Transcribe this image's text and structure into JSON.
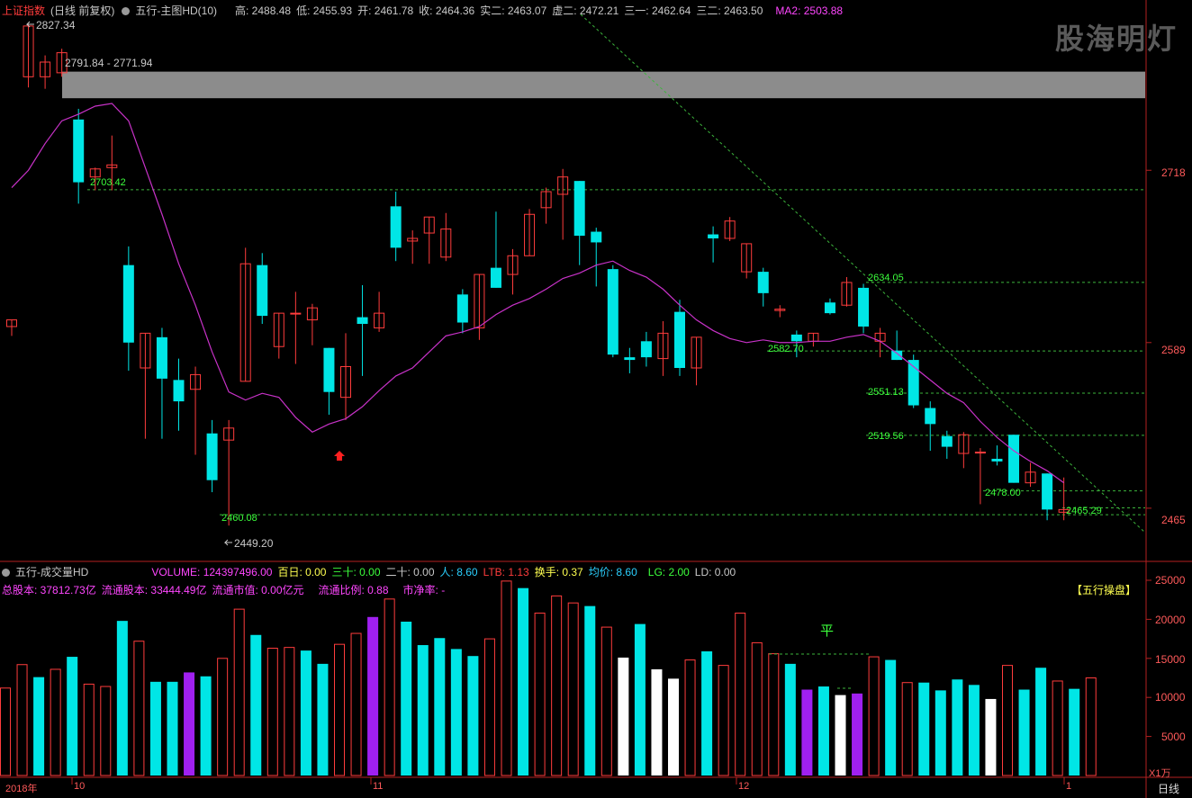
{
  "header": {
    "index_name": "上证指数",
    "period": "(日线 前复权)",
    "indicator_name": "五行-主图HD(10)",
    "high": "高: 2488.48",
    "low": "低: 2455.93",
    "open": "开: 2461.78",
    "close": "收: 2464.36",
    "shi2": "实二: 2463.07",
    "xu2": "虚二: 2472.21",
    "san1": "三一: 2462.64",
    "san2": "三二: 2463.50",
    "ma2": "MA2: 2503.88"
  },
  "watermark": "股海明灯",
  "price_axis": [
    "2718",
    "2589",
    "2465"
  ],
  "price_annotations": {
    "max": "2827.34",
    "min": "2449.20",
    "zone": "2791.84 - 2771.94",
    "levels": [
      "2703.42",
      "2634.05",
      "2582.70",
      "2551.13",
      "2519.56",
      "2478.00",
      "2465.29",
      "2460.08"
    ]
  },
  "volume_header": {
    "title": "五行-成交量HD",
    "volume": "VOLUME: 124397496.00",
    "bairi": "百日: 0.00",
    "sanshi": "三十: 0.00",
    "ershi": "二十: 0.00",
    "ren": "人: 8.60",
    "ltb": "LTB: 1.13",
    "huanshou": "换手: 0.37",
    "junjia": "均价: 8.60",
    "lg": "LG: 2.00",
    "ld": "LD: 0.00"
  },
  "info_row": {
    "total_shares": "总股本: 37812.73亿",
    "float_shares": "流通股本: 33444.49亿",
    "float_value": "流通市值: 0.00亿元",
    "float_ratio": "流通比例: 0.88",
    "pb": "市净率: -"
  },
  "badge": "【五行操盘】",
  "volume_axis": [
    "25000",
    "20000",
    "15000",
    "10000",
    "5000"
  ],
  "volume_unit": "X1万",
  "ping_label": "平",
  "date_axis": [
    "2018年",
    "10",
    "11",
    "12",
    "1"
  ],
  "period_button": "日线",
  "colors": {
    "up": "#ff3c3c",
    "down": "#00e6e6",
    "ma": "#c832c8",
    "guide": "#3cb43c"
  },
  "chart_data": {
    "type": "candlestick",
    "price_ylim": [
      2440,
      2832
    ],
    "candles": [
      {
        "o": 2601,
        "h": 2606,
        "l": 2594,
        "c": 2606
      },
      {
        "o": 2788,
        "h": 2827,
        "l": 2780,
        "c": 2826
      },
      {
        "o": 2788,
        "h": 2804,
        "l": 2779,
        "c": 2799
      },
      {
        "o": 2791,
        "h": 2809,
        "l": 2788,
        "c": 2806
      },
      {
        "o": 2756,
        "h": 2764,
        "l": 2693,
        "c": 2709
      },
      {
        "o": 2713,
        "h": 2720,
        "l": 2703,
        "c": 2719
      },
      {
        "o": 2720,
        "h": 2744,
        "l": 2703,
        "c": 2722
      },
      {
        "o": 2647,
        "h": 2661,
        "l": 2568,
        "c": 2589
      },
      {
        "o": 2570,
        "h": 2587,
        "l": 2517,
        "c": 2596
      },
      {
        "o": 2593,
        "h": 2600,
        "l": 2517,
        "c": 2562
      },
      {
        "o": 2561,
        "h": 2577,
        "l": 2523,
        "c": 2545
      },
      {
        "o": 2554,
        "h": 2571,
        "l": 2505,
        "c": 2565
      },
      {
        "o": 2521,
        "h": 2531,
        "l": 2477,
        "c": 2486
      },
      {
        "o": 2516,
        "h": 2531,
        "l": 2452,
        "c": 2525
      },
      {
        "o": 2560,
        "h": 2660,
        "l": 2560,
        "c": 2648
      },
      {
        "o": 2647,
        "h": 2656,
        "l": 2603,
        "c": 2609
      },
      {
        "o": 2586,
        "h": 2611,
        "l": 2577,
        "c": 2611
      },
      {
        "o": 2611,
        "h": 2627,
        "l": 2573,
        "c": 2611
      },
      {
        "o": 2606,
        "h": 2618,
        "l": 2587,
        "c": 2615
      },
      {
        "o": 2585,
        "h": 2580,
        "l": 2535,
        "c": 2552
      },
      {
        "o": 2548,
        "h": 2596,
        "l": 2531,
        "c": 2571
      },
      {
        "o": 2608,
        "h": 2632,
        "l": 2564,
        "c": 2603
      },
      {
        "o": 2600,
        "h": 2627,
        "l": 2597,
        "c": 2611
      },
      {
        "o": 2691,
        "h": 2702,
        "l": 2650,
        "c": 2660
      },
      {
        "o": 2665,
        "h": 2673,
        "l": 2648,
        "c": 2667
      },
      {
        "o": 2671,
        "h": 2674,
        "l": 2648,
        "c": 2683
      },
      {
        "o": 2653,
        "h": 2686,
        "l": 2650,
        "c": 2674
      },
      {
        "o": 2625,
        "h": 2629,
        "l": 2596,
        "c": 2604
      },
      {
        "o": 2600,
        "h": 2636,
        "l": 2591,
        "c": 2640
      },
      {
        "o": 2645,
        "h": 2687,
        "l": 2638,
        "c": 2630
      },
      {
        "o": 2640,
        "h": 2659,
        "l": 2625,
        "c": 2654
      },
      {
        "o": 2654,
        "h": 2689,
        "l": 2654,
        "c": 2685
      },
      {
        "o": 2690,
        "h": 2705,
        "l": 2678,
        "c": 2702
      },
      {
        "o": 2700,
        "h": 2719,
        "l": 2666,
        "c": 2713
      },
      {
        "o": 2710,
        "h": 2701,
        "l": 2647,
        "c": 2669
      },
      {
        "o": 2672,
        "h": 2675,
        "l": 2631,
        "c": 2664
      },
      {
        "o": 2644,
        "h": 2647,
        "l": 2578,
        "c": 2580
      },
      {
        "o": 2578,
        "h": 2585,
        "l": 2566,
        "c": 2576
      },
      {
        "o": 2590,
        "h": 2597,
        "l": 2571,
        "c": 2578
      },
      {
        "o": 2577,
        "h": 2605,
        "l": 2564,
        "c": 2596
      },
      {
        "o": 2612,
        "h": 2621,
        "l": 2564,
        "c": 2570
      },
      {
        "o": 2570,
        "h": 2582,
        "l": 2557,
        "c": 2593
      },
      {
        "o": 2670,
        "h": 2676,
        "l": 2649,
        "c": 2667
      },
      {
        "o": 2667,
        "h": 2683,
        "l": 2665,
        "c": 2680
      },
      {
        "o": 2642,
        "h": 2662,
        "l": 2637,
        "c": 2663
      },
      {
        "o": 2642,
        "h": 2645,
        "l": 2616,
        "c": 2626
      },
      {
        "o": 2613,
        "h": 2617,
        "l": 2608,
        "c": 2614
      },
      {
        "o": 2595,
        "h": 2598,
        "l": 2578,
        "c": 2590
      },
      {
        "o": 2590,
        "h": 2595,
        "l": 2586,
        "c": 2596
      },
      {
        "o": 2619,
        "h": 2622,
        "l": 2610,
        "c": 2611
      },
      {
        "o": 2617,
        "h": 2638,
        "l": 2616,
        "c": 2634
      },
      {
        "o": 2630,
        "h": 2633,
        "l": 2596,
        "c": 2601
      },
      {
        "o": 2590,
        "h": 2600,
        "l": 2578,
        "c": 2596
      },
      {
        "o": 2583,
        "h": 2598,
        "l": 2576,
        "c": 2576
      },
      {
        "o": 2576,
        "h": 2580,
        "l": 2540,
        "c": 2542
      },
      {
        "o": 2540,
        "h": 2545,
        "l": 2508,
        "c": 2528
      },
      {
        "o": 2519,
        "h": 2523,
        "l": 2502,
        "c": 2511
      },
      {
        "o": 2506,
        "h": 2522,
        "l": 2495,
        "c": 2520
      },
      {
        "o": 2507,
        "h": 2510,
        "l": 2468,
        "c": 2507
      },
      {
        "o": 2502,
        "h": 2512,
        "l": 2497,
        "c": 2500
      },
      {
        "o": 2520,
        "h": 2520,
        "l": 2484,
        "c": 2484
      },
      {
        "o": 2484,
        "h": 2499,
        "l": 2481,
        "c": 2492
      },
      {
        "o": 2491,
        "h": 2491,
        "l": 2456,
        "c": 2464
      },
      {
        "o": 2462,
        "h": 2488,
        "l": 2456,
        "c": 2464
      }
    ],
    "ma2": [
      2705,
      2718,
      2738,
      2755,
      2760,
      2766,
      2768,
      2755,
      2720,
      2685,
      2648,
      2617,
      2582,
      2552,
      2546,
      2551,
      2548,
      2533,
      2522,
      2528,
      2532,
      2541,
      2553,
      2564,
      2570,
      2582,
      2594,
      2597,
      2601,
      2610,
      2617,
      2622,
      2629,
      2637,
      2641,
      2647,
      2650,
      2643,
      2638,
      2629,
      2617,
      2606,
      2598,
      2592,
      2589,
      2591,
      2589,
      2589,
      2590,
      2590,
      2593,
      2595,
      2590,
      2581,
      2571,
      2561,
      2551,
      2544,
      2530,
      2518,
      2508,
      2500,
      2493,
      2484
    ],
    "volume_ylim": [
      0,
      25000
    ],
    "volumes": [
      {
        "v": 11200,
        "k": "up"
      },
      {
        "v": 14200,
        "k": "up"
      },
      {
        "v": 12600,
        "k": "cyan"
      },
      {
        "v": 13600,
        "k": "up"
      },
      {
        "v": 15200,
        "k": "cyan"
      },
      {
        "v": 11700,
        "k": "up"
      },
      {
        "v": 11400,
        "k": "up"
      },
      {
        "v": 19800,
        "k": "cyan"
      },
      {
        "v": 17200,
        "k": "up"
      },
      {
        "v": 12000,
        "k": "cyan"
      },
      {
        "v": 12000,
        "k": "cyan"
      },
      {
        "v": 13200,
        "k": "purple"
      },
      {
        "v": 12700,
        "k": "cyan"
      },
      {
        "v": 15000,
        "k": "up"
      },
      {
        "v": 21300,
        "k": "up"
      },
      {
        "v": 18000,
        "k": "cyan"
      },
      {
        "v": 16300,
        "k": "up"
      },
      {
        "v": 16400,
        "k": "up"
      },
      {
        "v": 16000,
        "k": "cyan"
      },
      {
        "v": 14300,
        "k": "cyan"
      },
      {
        "v": 16800,
        "k": "up"
      },
      {
        "v": 18200,
        "k": "up"
      },
      {
        "v": 20300,
        "k": "purple"
      },
      {
        "v": 22600,
        "k": "up"
      },
      {
        "v": 19700,
        "k": "cyan"
      },
      {
        "v": 16700,
        "k": "cyan"
      },
      {
        "v": 17600,
        "k": "cyan"
      },
      {
        "v": 16200,
        "k": "cyan"
      },
      {
        "v": 15300,
        "k": "cyan"
      },
      {
        "v": 17500,
        "k": "up"
      },
      {
        "v": 24900,
        "k": "up"
      },
      {
        "v": 24000,
        "k": "cyan"
      },
      {
        "v": 20800,
        "k": "up"
      },
      {
        "v": 23000,
        "k": "up"
      },
      {
        "v": 22100,
        "k": "up"
      },
      {
        "v": 21700,
        "k": "cyan"
      },
      {
        "v": 19000,
        "k": "up"
      },
      {
        "v": 15100,
        "k": "white"
      },
      {
        "v": 19400,
        "k": "cyan"
      },
      {
        "v": 13600,
        "k": "white"
      },
      {
        "v": 12400,
        "k": "white"
      },
      {
        "v": 14800,
        "k": "up"
      },
      {
        "v": 15900,
        "k": "cyan"
      },
      {
        "v": 14100,
        "k": "up"
      },
      {
        "v": 20800,
        "k": "up"
      },
      {
        "v": 17000,
        "k": "up"
      },
      {
        "v": 15600,
        "k": "up"
      },
      {
        "v": 14300,
        "k": "cyan"
      },
      {
        "v": 11000,
        "k": "purple"
      },
      {
        "v": 11400,
        "k": "cyan"
      },
      {
        "v": 10300,
        "k": "white"
      },
      {
        "v": 10500,
        "k": "purple"
      },
      {
        "v": 15200,
        "k": "up"
      },
      {
        "v": 14800,
        "k": "cyan"
      },
      {
        "v": 11900,
        "k": "up"
      },
      {
        "v": 11900,
        "k": "cyan"
      },
      {
        "v": 10900,
        "k": "cyan"
      },
      {
        "v": 12300,
        "k": "cyan"
      },
      {
        "v": 11600,
        "k": "cyan"
      },
      {
        "v": 9800,
        "k": "white"
      },
      {
        "v": 14100,
        "k": "up"
      },
      {
        "v": 11000,
        "k": "cyan"
      },
      {
        "v": 13800,
        "k": "cyan"
      },
      {
        "v": 12100,
        "k": "up"
      },
      {
        "v": 11100,
        "k": "cyan"
      },
      {
        "v": 12500,
        "k": "up"
      }
    ]
  }
}
